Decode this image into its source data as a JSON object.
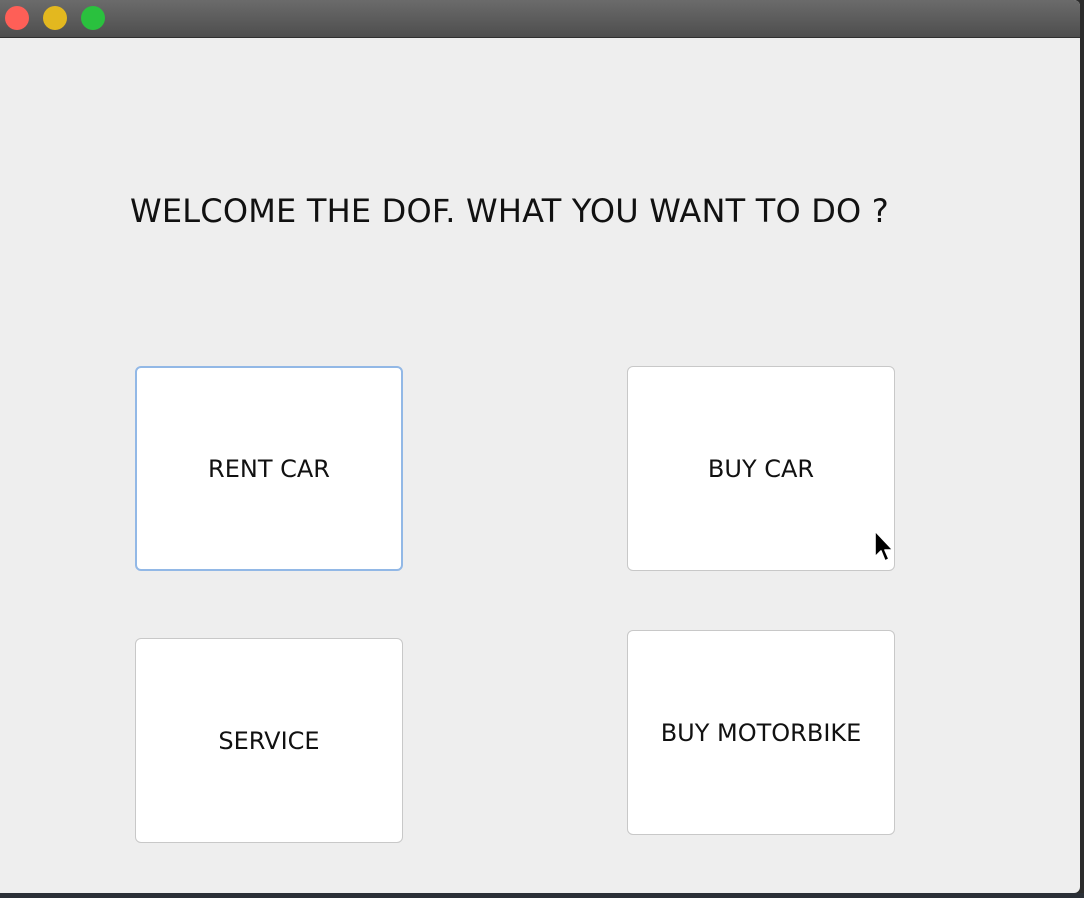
{
  "window": {
    "controls": [
      "close",
      "minimize",
      "maximize"
    ],
    "colors": {
      "close": "#fe5f57",
      "minimize": "#e3b81f",
      "maximize": "#2ac13e",
      "focus_border": "#92b8e6",
      "background": "#eeeeee"
    }
  },
  "main": {
    "heading": "WELCOME THE DOF. WHAT YOU WANT TO DO ?",
    "buttons": {
      "rent_car": "RENT CAR",
      "buy_car": "BUY CAR",
      "service": "SERVICE",
      "buy_motorbike": "BUY MOTORBIKE"
    },
    "focused_button": "rent_car"
  },
  "pointer": {
    "icon": "mouse-pointer-icon"
  }
}
